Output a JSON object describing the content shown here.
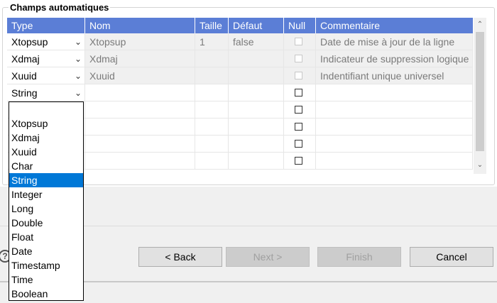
{
  "group": {
    "title": "Champs automatiques"
  },
  "grid": {
    "columns": [
      "Type",
      "Nom",
      "Taille",
      "Défaut",
      "Null",
      "Commentaire"
    ],
    "rows": [
      {
        "type": "Xtopsup",
        "nom": "Xtopsup",
        "taille": "1",
        "defaut": "false",
        "null_checked": false,
        "null_enabled": false,
        "commentaire": "Date de mise à jour de la ligne"
      },
      {
        "type": "Xdmaj",
        "nom": "Xdmaj",
        "taille": "",
        "defaut": "",
        "null_checked": false,
        "null_enabled": false,
        "commentaire": "Indicateur de suppression logique"
      },
      {
        "type": "Xuuid",
        "nom": "Xuuid",
        "taille": "",
        "defaut": "",
        "null_checked": false,
        "null_enabled": false,
        "commentaire": "Indentifiant unique universel"
      },
      {
        "type": "String",
        "nom": "",
        "taille": "",
        "defaut": "",
        "null_checked": false,
        "null_enabled": true,
        "commentaire": ""
      }
    ]
  },
  "dropdown": {
    "options": [
      "",
      "Xtopsup",
      "Xdmaj",
      "Xuuid",
      "Char",
      "String",
      "Integer",
      "Long",
      "Double",
      "Float",
      "Date",
      "Timestamp",
      "Time",
      "Boolean"
    ],
    "selected": "String"
  },
  "buttons": {
    "back": "< Back",
    "next": "Next >",
    "finish": "Finish",
    "cancel": "Cancel"
  },
  "help": {
    "glyph": "?"
  }
}
